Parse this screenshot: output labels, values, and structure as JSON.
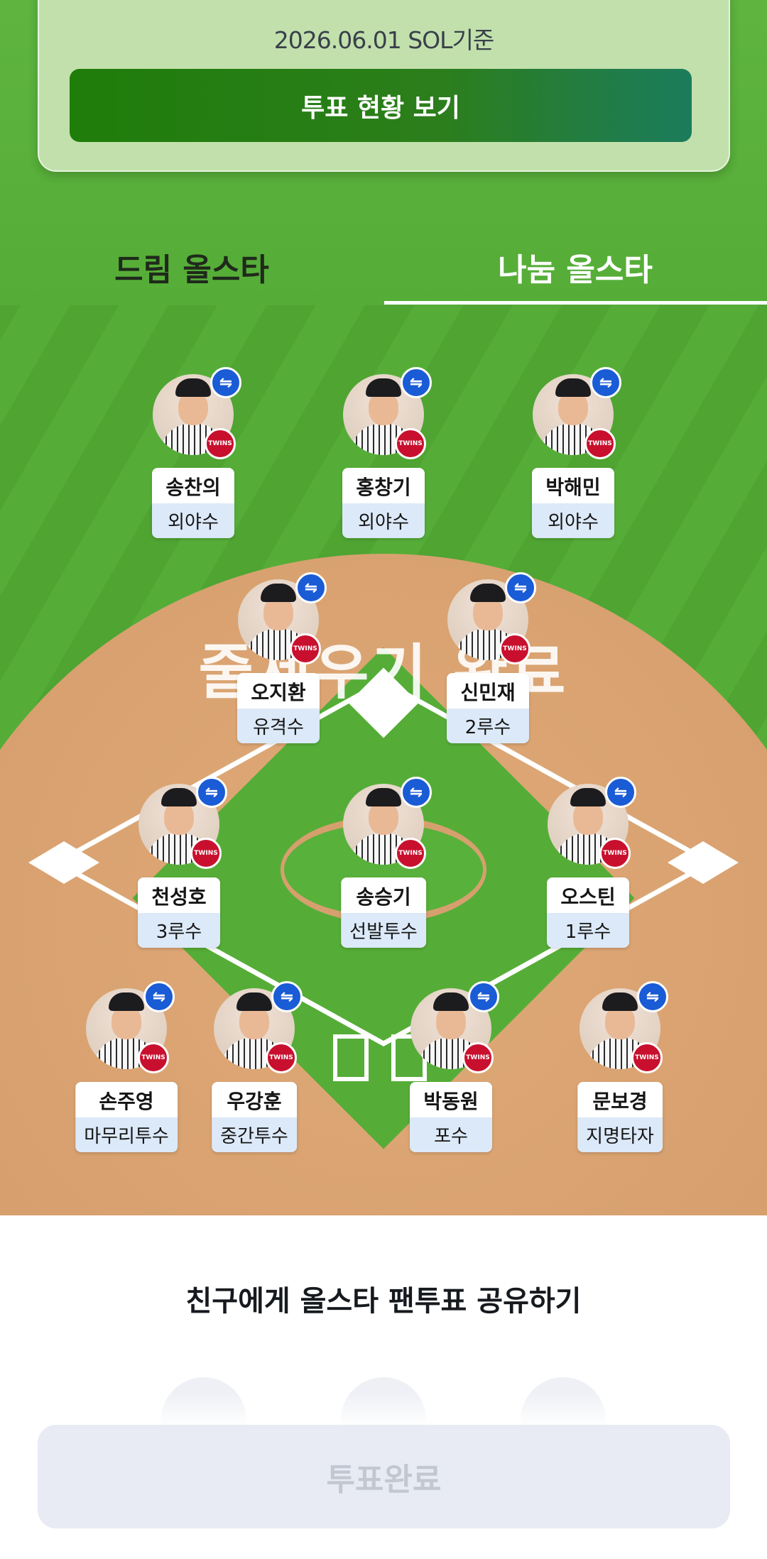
{
  "card": {
    "date_label": "2026.06.01 SOL기준",
    "vote_status_button": "투표 현황 보기"
  },
  "tabs": [
    {
      "label": "드림 올스타",
      "selected": false
    },
    {
      "label": "나눔 올스타",
      "selected": true
    }
  ],
  "overlay_text": "줄세우기 완료",
  "players": [
    {
      "name": "송찬의",
      "position": "외야수"
    },
    {
      "name": "홍창기",
      "position": "외야수"
    },
    {
      "name": "박해민",
      "position": "외야수"
    },
    {
      "name": "오지환",
      "position": "유격수"
    },
    {
      "name": "신민재",
      "position": "2루수"
    },
    {
      "name": "천성호",
      "position": "3루수"
    },
    {
      "name": "송승기",
      "position": "선발투수"
    },
    {
      "name": "오스틴",
      "position": "1루수"
    },
    {
      "name": "손주영",
      "position": "마무리투수"
    },
    {
      "name": "우강훈",
      "position": "중간투수"
    },
    {
      "name": "박동원",
      "position": "포수"
    },
    {
      "name": "문보경",
      "position": "지명타자"
    }
  ],
  "team_badge_text": "TWINS",
  "icons": {
    "swap": "swap-arrows-icon",
    "team": "twins-team-logo-icon"
  },
  "share": {
    "title": "친구에게 올스타 팬투표 공유하기"
  },
  "bottom_button": "투표완료",
  "colors": {
    "accent_green": "#1f7d0a",
    "swap_badge_blue": "#1a5bd6",
    "team_red": "#c8102e",
    "disabled_button": "#e8ebf3"
  }
}
